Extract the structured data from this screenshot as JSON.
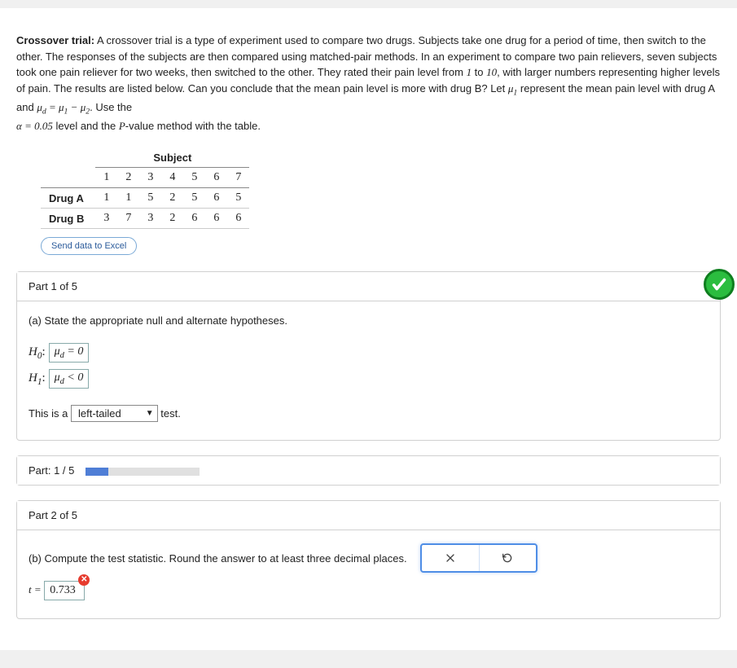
{
  "intro": {
    "lead": "Crossover trial:",
    "body1": " A crossover trial is a type of experiment used to compare two drugs. Subjects take one drug for a period of time, then switch to the other. The responses of the subjects are then compared using matched-pair methods. In an experiment to compare two pain relievers, seven subjects took one pain reliever for two weeks, then switched to the other. They rated their pain level from ",
    "range_lo": "1",
    "range_mid": " to ",
    "range_hi": "10",
    "body2": ", with larger numbers representing higher levels of pain. The results are listed below. Can you conclude that the mean pain level is more with drug B? Let ",
    "mu1": "μ",
    "mu1_sub": "1",
    "body3": " represent the mean pain level with drug A and ",
    "mud": "μ",
    "mud_sub": "d",
    "eq": " = ",
    "mu1b": "μ",
    "mu1b_sub": "1",
    "minus": " − ",
    "mu2": "μ",
    "mu2_sub": "2",
    "body4": ". Use the ",
    "alpha": "α = 0.05",
    "body5": " level and the ",
    "pval": "P",
    "body6": "-value method with the table."
  },
  "table": {
    "subject_label": "Subject",
    "cols": [
      "1",
      "2",
      "3",
      "4",
      "5",
      "6",
      "7"
    ],
    "rowA_label": "Drug A",
    "rowA": [
      "1",
      "1",
      "5",
      "2",
      "5",
      "6",
      "5"
    ],
    "rowB_label": "Drug B",
    "rowB": [
      "3",
      "7",
      "3",
      "2",
      "6",
      "6",
      "6"
    ]
  },
  "send_excel": "Send data to Excel",
  "part1": {
    "header": "Part 1 of 5",
    "prompt": "(a) State the appropriate null and alternate hypotheses.",
    "H0_label": "H",
    "H0_sub": "0",
    "colon": ":",
    "H0_ans": "μ",
    "H0_ans_sub": "d",
    "H0_ans_rest": " = 0",
    "H1_label": "H",
    "H1_sub": "1",
    "H1_ans": "μ",
    "H1_ans_sub": "d",
    "H1_ans_rest": " < 0",
    "tail_pre": "This is a ",
    "tail_value": "left-tailed",
    "tail_post": " test."
  },
  "progress": {
    "label": "Part: 1 / 5"
  },
  "part2": {
    "header": "Part 2 of 5",
    "prompt": "(b) Compute the test statistic. Round the answer to at least three decimal places.",
    "t_label": "t =",
    "t_value": "0.733"
  }
}
